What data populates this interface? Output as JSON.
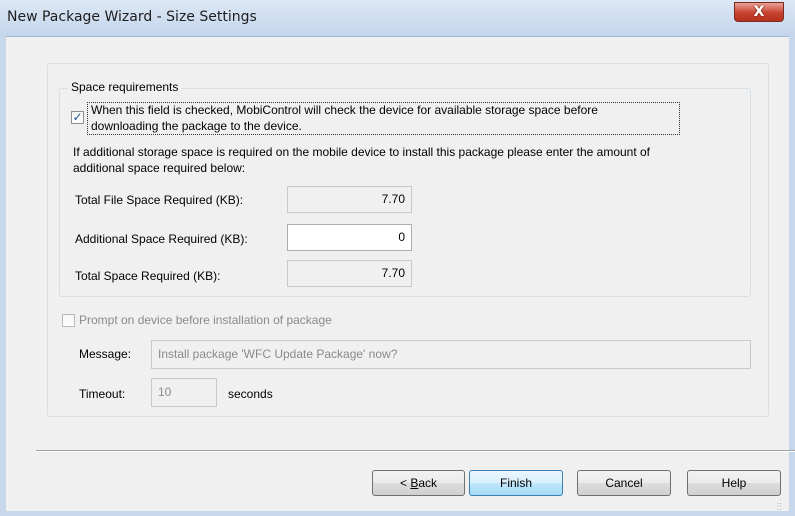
{
  "window": {
    "title": "New Package Wizard - Size Settings",
    "close_glyph": "X"
  },
  "space": {
    "legend": "Space requirements",
    "check_label_line1": "When this field is checked, MobiControl will check the device for available storage space before",
    "check_label_line2": "downloading the package to the device.",
    "checked": true,
    "info_line1": "If additional storage space is required on the mobile device to install this package please enter the amount of",
    "info_line2": "additional space required below:",
    "total_file_label": "Total File Space Required (KB):",
    "total_file_value": "7.70",
    "additional_label": "Additional Space Required (KB):",
    "additional_value": "0",
    "total_label": "Total Space Required (KB):",
    "total_value": "7.70"
  },
  "prompt": {
    "check_label": "Prompt on device before installation of package",
    "checked": false,
    "message_label": "Message:",
    "message_value": "Install package 'WFC Update Package' now?",
    "timeout_label": "Timeout:",
    "timeout_value": "10",
    "timeout_unit": "seconds"
  },
  "buttons": {
    "back_prefix": "< ",
    "back_mnemonic": "B",
    "back_rest": "ack",
    "finish": "Finish",
    "cancel": "Cancel",
    "help": "Help"
  },
  "icons": {
    "close": "close-icon",
    "check": "checkmark-icon",
    "grip": "resize-grip-icon"
  },
  "colors": {
    "title_bar": "#c5d6ec",
    "close_button": "#c8432f",
    "dialog_bg": "#f0f0f0",
    "default_button": "#bee6fd"
  }
}
